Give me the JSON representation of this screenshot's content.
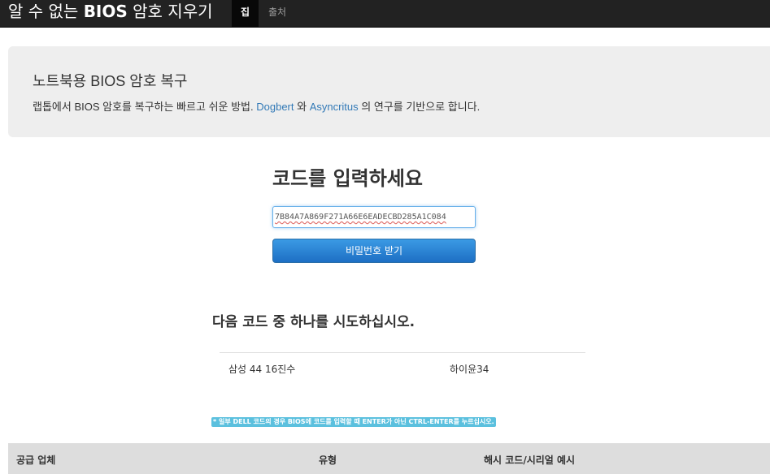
{
  "navbar": {
    "brand_prefix": "알 수 없는 ",
    "brand_bold": "BIOS",
    "brand_suffix": " 암호 지우기",
    "items": [
      {
        "label": "집",
        "active": true
      },
      {
        "label": "출처",
        "active": false
      }
    ]
  },
  "jumbotron": {
    "title": "노트북용 BIOS 암호 복구",
    "desc_prefix": "랩톱에서 BIOS 암호를 복구하는 빠르고 쉬운 방법. ",
    "link1": "Dogbert",
    "desc_middle": " 와 ",
    "link2": "Asyncritus",
    "desc_suffix": " 의 연구를 기반으로 합니다."
  },
  "form": {
    "heading": "코드를 입력하세요",
    "input_value": "7B84A7A869F271A66E6EADECBD285A1C084",
    "button_label": "비밀번호 받기"
  },
  "results": {
    "heading": "다음 코드 중 하나를 시도하십시오.",
    "cells": [
      "삼성  44 16진수",
      "하이윤34"
    ]
  },
  "note": "* 일부 DELL 코드의 경우 BIOS에 코드를 입력할 때 ENTER가 아닌 CTRL-ENTER를 누르십시오.",
  "table": {
    "headers": [
      "공급 업체",
      "유형",
      "해시 코드/시리얼 예시"
    ]
  },
  "colors": {
    "navbar_bg": "#222222",
    "link": "#337ab7",
    "button": "#1d6fc4",
    "note_bg": "#5bc0de"
  }
}
